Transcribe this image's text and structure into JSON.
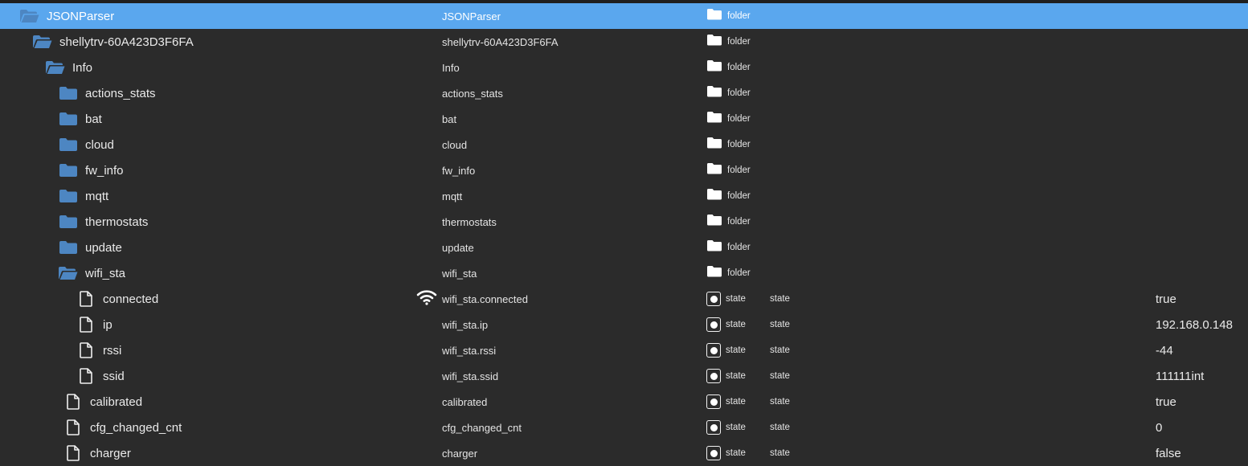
{
  "colors": {
    "background": "#2b2b2b",
    "selected_row": "#5aa7ee",
    "folder_icon": "#4d86c2",
    "text": "#eaeaea"
  },
  "rows": [
    {
      "name": "JSONParser",
      "id": "JSONParser",
      "type": "folder",
      "icon": "folder-open-icon",
      "selected": true
    },
    {
      "name": "shellytrv-60A423D3F6FA",
      "id": "shellytrv-60A423D3F6FA",
      "type": "folder",
      "icon": "folder-open-icon"
    },
    {
      "name": "Info",
      "id": "Info",
      "type": "folder",
      "icon": "folder-open-icon"
    },
    {
      "name": "actions_stats",
      "id": "actions_stats",
      "type": "folder",
      "icon": "folder-icon"
    },
    {
      "name": "bat",
      "id": "bat",
      "type": "folder",
      "icon": "folder-icon"
    },
    {
      "name": "cloud",
      "id": "cloud",
      "type": "folder",
      "icon": "folder-icon"
    },
    {
      "name": "fw_info",
      "id": "fw_info",
      "type": "folder",
      "icon": "folder-icon"
    },
    {
      "name": "mqtt",
      "id": "mqtt",
      "type": "folder",
      "icon": "folder-icon"
    },
    {
      "name": "thermostats",
      "id": "thermostats",
      "type": "folder",
      "icon": "folder-icon"
    },
    {
      "name": "update",
      "id": "update",
      "type": "folder",
      "icon": "folder-icon"
    },
    {
      "name": "wifi_sta",
      "id": "wifi_sta",
      "type": "folder",
      "icon": "folder-open-icon"
    },
    {
      "name": "connected",
      "id": "wifi_sta.connected",
      "type": "state",
      "role": "state",
      "value": "true",
      "icon": "file-icon",
      "role_icon": "wifi-icon"
    },
    {
      "name": "ip",
      "id": "wifi_sta.ip",
      "type": "state",
      "role": "state",
      "value": "192.168.0.148",
      "icon": "file-icon"
    },
    {
      "name": "rssi",
      "id": "wifi_sta.rssi",
      "type": "state",
      "role": "state",
      "value": "-44",
      "icon": "file-icon"
    },
    {
      "name": "ssid",
      "id": "wifi_sta.ssid",
      "type": "state",
      "role": "state",
      "value": "111111int",
      "icon": "file-icon"
    },
    {
      "name": "calibrated",
      "id": "calibrated",
      "type": "state",
      "role": "state",
      "value": "true",
      "icon": "file-icon"
    },
    {
      "name": "cfg_changed_cnt",
      "id": "cfg_changed_cnt",
      "type": "state",
      "role": "state",
      "value": "0",
      "icon": "file-icon"
    },
    {
      "name": "charger",
      "id": "charger",
      "type": "state",
      "role": "state",
      "value": "false",
      "icon": "file-icon"
    }
  ]
}
